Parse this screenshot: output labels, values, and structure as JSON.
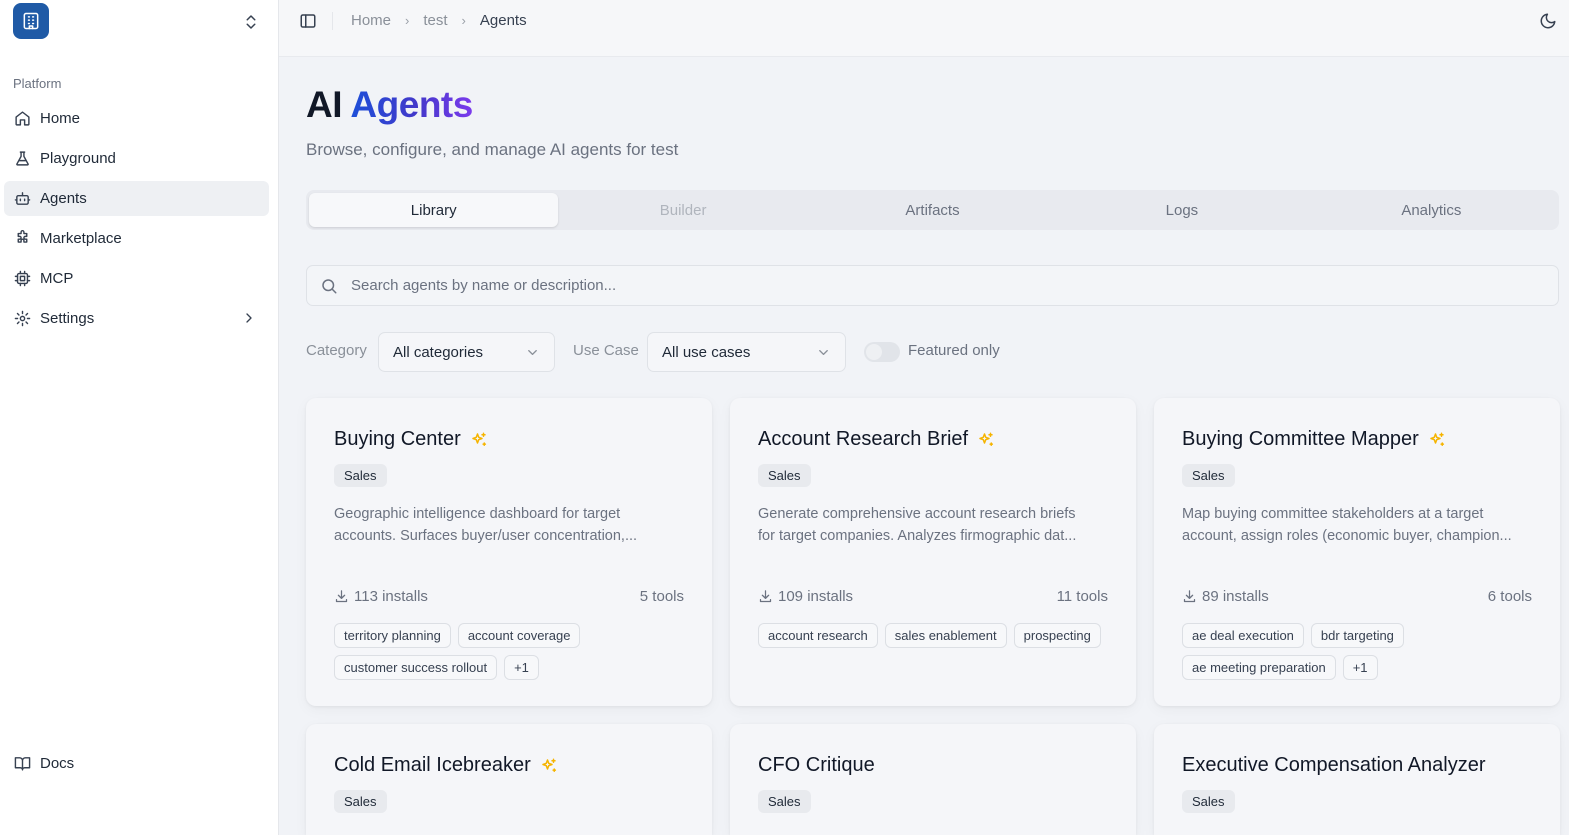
{
  "sidebar": {
    "section": "Platform",
    "items": [
      {
        "label": "Home"
      },
      {
        "label": "Playground"
      },
      {
        "label": "Agents"
      },
      {
        "label": "Marketplace"
      },
      {
        "label": "MCP"
      },
      {
        "label": "Settings"
      }
    ],
    "footer": {
      "label": "Docs"
    }
  },
  "breadcrumb": {
    "items": [
      "Home",
      "test",
      "Agents"
    ]
  },
  "page": {
    "title_plain": "AI",
    "title_accent": "Agents",
    "subtitle": "Browse, configure, and manage AI agents for test"
  },
  "tabs": [
    "Library",
    "Builder",
    "Artifacts",
    "Logs",
    "Analytics"
  ],
  "search": {
    "placeholder": "Search agents by name or description..."
  },
  "filters": {
    "category_label": "Category",
    "category_value": "All categories",
    "usecase_label": "Use Case",
    "usecase_value": "All use cases",
    "featured_label": "Featured only"
  },
  "colors": {
    "accent": "#1f5aa6",
    "sparkle": "#f5b400"
  },
  "cards": [
    {
      "title": "Buying Center",
      "featured": true,
      "category": "Sales",
      "desc1": "Geographic intelligence dashboard for target",
      "desc2": "accounts. Surfaces buyer/user concentration,...",
      "installs": "113 installs",
      "tools": "5 tools",
      "tags": [
        "territory planning",
        "account coverage",
        "customer success rollout",
        "+1"
      ]
    },
    {
      "title": "Account Research Brief",
      "featured": true,
      "category": "Sales",
      "desc1": "Generate comprehensive account research briefs",
      "desc2": "for target companies. Analyzes firmographic dat...",
      "installs": "109 installs",
      "tools": "11 tools",
      "tags": [
        "account research",
        "sales enablement",
        "prospecting"
      ]
    },
    {
      "title": "Buying Committee Mapper",
      "featured": true,
      "category": "Sales",
      "desc1": "Map buying committee stakeholders at a target",
      "desc2": "account, assign roles (economic buyer, champion...",
      "installs": "89 installs",
      "tools": "6 tools",
      "tags": [
        "ae deal execution",
        "bdr targeting",
        "ae meeting preparation",
        "+1"
      ]
    },
    {
      "title": "Cold Email Icebreaker",
      "featured": true,
      "category": "Sales"
    },
    {
      "title": "CFO Critique",
      "featured": false,
      "category": "Sales"
    },
    {
      "title": "Executive Compensation Analyzer",
      "featured": false,
      "category": "Sales"
    }
  ]
}
